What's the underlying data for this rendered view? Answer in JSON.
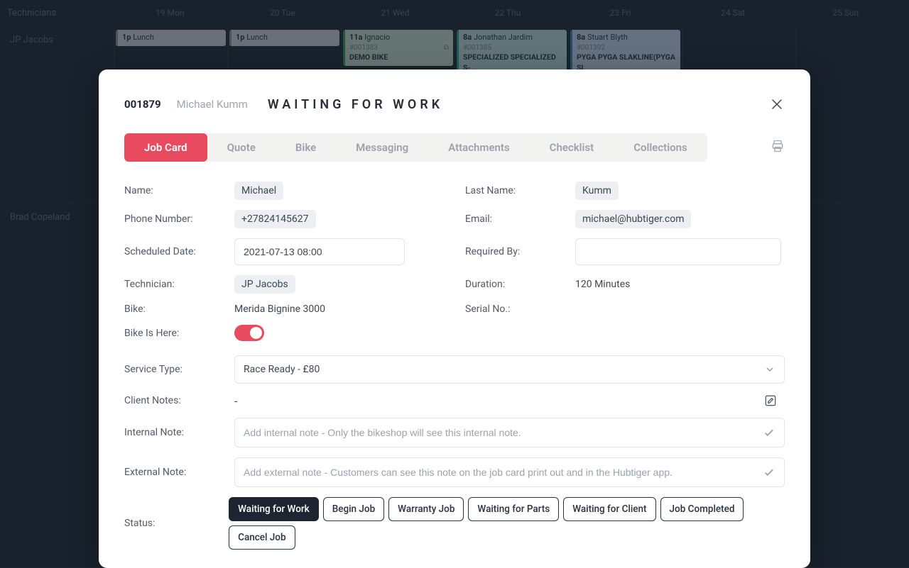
{
  "background": {
    "header": {
      "technicians_label": "Technicians",
      "days": [
        "19 Mon",
        "20 Tue",
        "21 Wed",
        "22 Thu",
        "23 Fri",
        "24 Sat",
        "25 Sun"
      ]
    },
    "tech1": "JP Jacobs",
    "tech2": "Brad Copeland",
    "events": {
      "mon_lunch_time": "1p",
      "mon_lunch_label": "Lunch",
      "tue_lunch_time": "1p",
      "tue_lunch_label": "Lunch",
      "wed_time": "11a",
      "wed_name": "Ignacio",
      "wed_id": "#001383",
      "wed_bike": "DEMO BIKE",
      "thu_time": "8a",
      "thu_name": "Jonathan Jardim",
      "thu_id": "#001385",
      "thu_bike": "SPECIALIZED SPECIALIZED S-…",
      "fri_time": "8a",
      "fri_name": "Stuart Blyth",
      "fri_id": "#001392",
      "fri_bike": "PYGA PYGA SLAKLINE(PYGA SL"
    }
  },
  "modal": {
    "job_number": "001879",
    "customer_name": "Michael Kumm",
    "status_title": "Waiting for Work",
    "tabs": {
      "job_card": "Job Card",
      "quote": "Quote",
      "bike": "Bike",
      "messaging": "Messaging",
      "attachments": "Attachments",
      "checklist": "Checklist",
      "collections": "Collections"
    },
    "labels": {
      "name": "Name:",
      "last_name": "Last Name:",
      "phone": "Phone Number:",
      "email": "Email:",
      "scheduled": "Scheduled Date:",
      "required": "Required By:",
      "technician": "Technician:",
      "duration": "Duration:",
      "bike": "Bike:",
      "serial": "Serial No.:",
      "bike_here": "Bike Is Here:",
      "service": "Service Type:",
      "client_notes": "Client Notes:",
      "internal_note": "Internal Note:",
      "external_note": "External Note:",
      "status": "Status:"
    },
    "values": {
      "first_name": "Michael",
      "last_name": "Kumm",
      "phone": "+27824145627",
      "email": "michael@hubtiger.com",
      "scheduled": "2021-07-13 08:00",
      "required": "",
      "technician": "JP Jacobs",
      "duration": "120 Minutes",
      "bike": "Merida Bignine 3000",
      "serial": "",
      "bike_here": true,
      "service": "Race Ready - £80",
      "client_notes": "-"
    },
    "placeholders": {
      "internal_note": "Add internal note - Only the bikeshop will see this internal note.",
      "external_note": "Add external note - Customers can see this note on the job card print out and in the Hubtiger app."
    },
    "status_buttons": {
      "waiting_work": "Waiting for Work",
      "begin": "Begin Job",
      "warranty": "Warranty Job",
      "waiting_parts": "Waiting for Parts",
      "waiting_client": "Waiting for Client",
      "completed": "Job Completed",
      "cancel": "Cancel Job",
      "active": "waiting_work"
    }
  }
}
